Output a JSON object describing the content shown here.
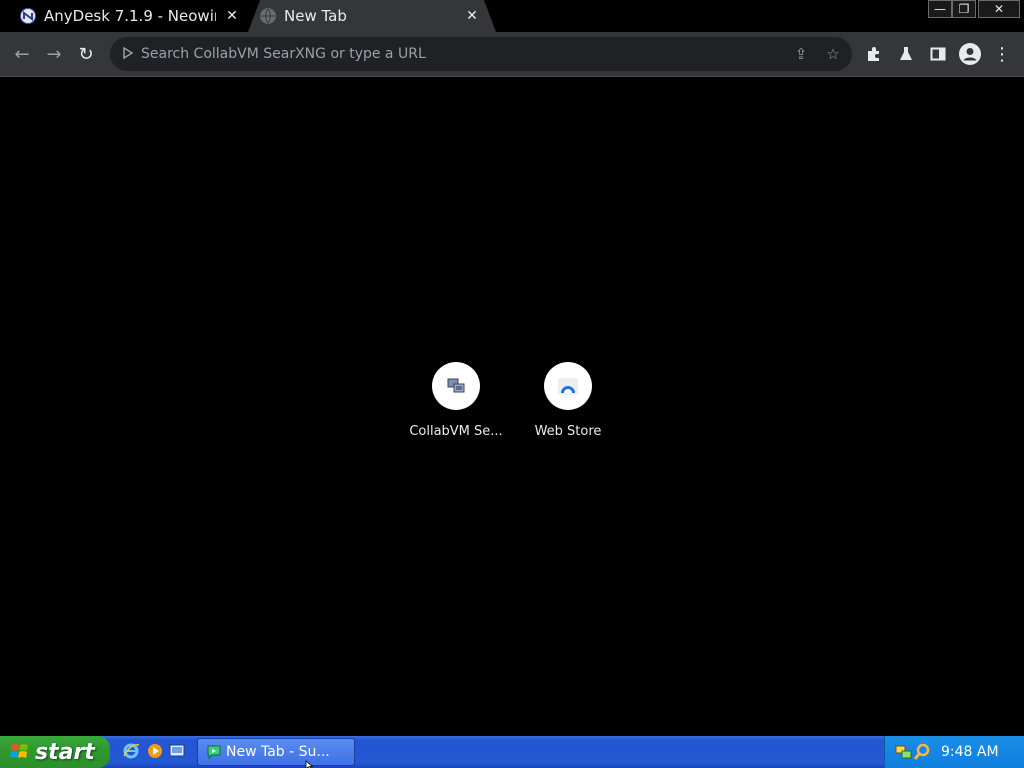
{
  "tabs": [
    {
      "title": "AnyDesk 7.1.9 - Neowin",
      "close": "✕",
      "favicon": "neowin-icon"
    },
    {
      "title": "New Tab",
      "close": "✕",
      "favicon": "globe-icon"
    }
  ],
  "window_controls": {
    "minimize": "—",
    "maximize": "❐",
    "close": "✕"
  },
  "toolbar": {
    "back": "←",
    "forward": "→",
    "reload": "↻",
    "omnibox_placeholder": "Search CollabVM SearXNG or type a URL",
    "share": "⇪",
    "bookmark": "☆",
    "extensions": "puzzle-icon",
    "labs": "flask-icon",
    "side_panel": "side-panel-icon",
    "profile": "profile-icon",
    "menu": "⋮"
  },
  "shortcuts": [
    {
      "label": "CollabVM Se...",
      "icon": "collabvm-icon"
    },
    {
      "label": "Web Store",
      "icon": "web-store-icon"
    }
  ],
  "taskbar": {
    "start_label": "start",
    "task_label": "New Tab - Su...",
    "clock": "9:48 AM"
  },
  "colors": {
    "tab_strip": "#000000",
    "toolbar": "#35363a",
    "omnibox": "#202124",
    "content_bg": "#000000",
    "taskbar": "#2357d4",
    "start_button": "#2f9a2f",
    "tray": "#0f7fde"
  }
}
